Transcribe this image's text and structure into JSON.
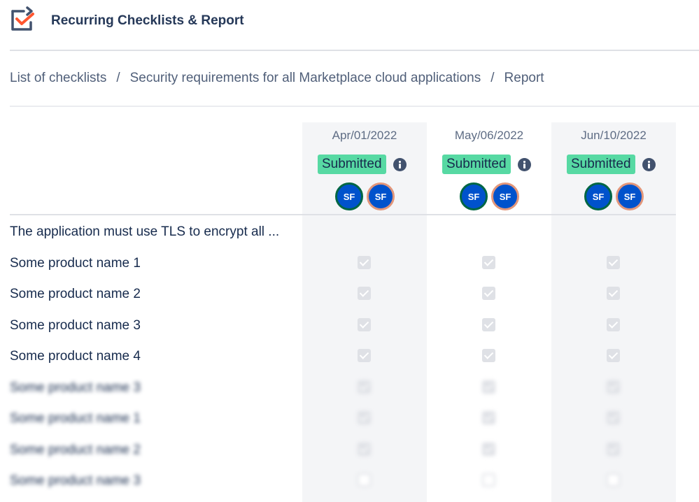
{
  "app": {
    "title": "Recurring Checklists & Report",
    "logo_icon": "checklist-logo-icon"
  },
  "breadcrumb": [
    {
      "label": "List of checklists"
    },
    {
      "label": "Security requirements for all Marketplace cloud applications"
    },
    {
      "label": "Report"
    }
  ],
  "breadcrumb_separator": "/",
  "columns": [
    {
      "date": "Apr/01/2022",
      "status": "Submitted",
      "avatars": [
        "SF",
        "SF"
      ]
    },
    {
      "date": "May/06/2022",
      "status": "Submitted",
      "avatars": [
        "SF",
        "SF"
      ]
    },
    {
      "date": "Jun/10/2022",
      "status": "Submitted",
      "avatars": [
        "SF",
        "SF"
      ]
    }
  ],
  "section_title": "The application must use TLS to encrypt all ...",
  "rows": [
    {
      "label": "Some product name 1",
      "checked": [
        true,
        true,
        true
      ]
    },
    {
      "label": "Some product name 2",
      "checked": [
        true,
        true,
        true
      ]
    },
    {
      "label": "Some product name 3",
      "checked": [
        true,
        true,
        true
      ]
    },
    {
      "label": "Some product name 4",
      "checked": [
        true,
        true,
        true
      ]
    },
    {
      "label": "Some product name 3",
      "checked": [
        true,
        true,
        true
      ],
      "blurred": true
    },
    {
      "label": "Some product name 1",
      "checked": [
        true,
        true,
        true
      ],
      "blurred": true
    },
    {
      "label": "Some product name 2",
      "checked": [
        true,
        true,
        true
      ],
      "blurred": true
    },
    {
      "label": "Some product name 3",
      "checked": [
        false,
        false,
        false
      ],
      "blurred": true
    }
  ],
  "colors": {
    "status_badge": "#57d9a3",
    "avatar": "#0052cc",
    "column_bg": "#f4f5f7"
  }
}
